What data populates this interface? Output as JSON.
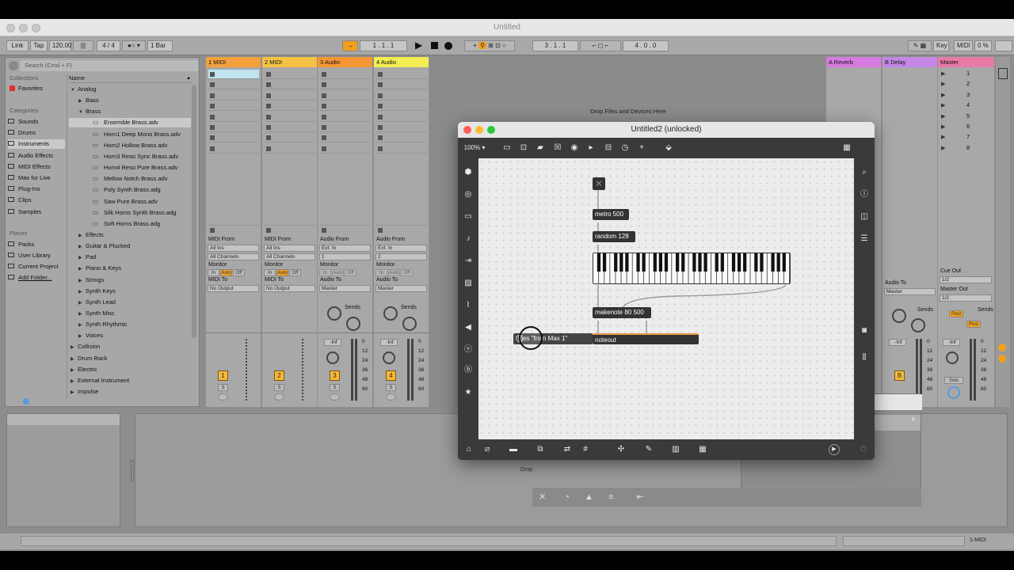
{
  "window": {
    "title": "Untitled"
  },
  "transport": {
    "link": "Link",
    "tap": "Tap",
    "tempo": "120.00",
    "signature": "4 / 4",
    "quantize": "1 Bar",
    "arrangement_pos": "1 . 1 . 1",
    "loop_start": "3 . 1 . 1",
    "loop_length": "4 . 0 . 0",
    "key": "Key",
    "midi": "MIDI",
    "cpu": "0 %"
  },
  "browser": {
    "search_placeholder": "Search (Cmd + F)",
    "collections_header": "Collections",
    "favorites": "Favorites",
    "categories_header": "Categories",
    "categories": [
      "Sounds",
      "Drums",
      "Instruments",
      "Audio Effects",
      "MIDI Effects",
      "Max for Live",
      "Plug-Ins",
      "Clips",
      "Samples"
    ],
    "places_header": "Places",
    "places": [
      "Packs",
      "User Library",
      "Current Project",
      "Add Folder..."
    ],
    "name_header": "Name",
    "tree": [
      {
        "label": "Analog",
        "depth": 0,
        "arrow": "▼"
      },
      {
        "label": "Bass",
        "depth": 1,
        "arrow": "▶"
      },
      {
        "label": "Brass",
        "depth": 1,
        "arrow": "▼"
      },
      {
        "label": "Ensemble Brass.adv",
        "depth": 2,
        "arrow": ""
      },
      {
        "label": "Horn1 Deep Mono Brass.adv",
        "depth": 2,
        "arrow": ""
      },
      {
        "label": "Horn2 Hollow Brass.adv",
        "depth": 2,
        "arrow": ""
      },
      {
        "label": "Horn3 Reso Sync Brass.adv",
        "depth": 2,
        "arrow": ""
      },
      {
        "label": "Horn4 Reso Pure Brass.adv",
        "depth": 2,
        "arrow": ""
      },
      {
        "label": "Mellow Notch Brass.adv",
        "depth": 2,
        "arrow": ""
      },
      {
        "label": "Poly Synth Brass.adg",
        "depth": 2,
        "arrow": ""
      },
      {
        "label": "Saw Pure Brass.adv",
        "depth": 2,
        "arrow": ""
      },
      {
        "label": "Silk Horns Synth Brass.adg",
        "depth": 2,
        "arrow": ""
      },
      {
        "label": "Soft Horns Brass.adg",
        "depth": 2,
        "arrow": ""
      },
      {
        "label": "Effects",
        "depth": 1,
        "arrow": "▶"
      },
      {
        "label": "Guitar & Plucked",
        "depth": 1,
        "arrow": "▶"
      },
      {
        "label": "Pad",
        "depth": 1,
        "arrow": "▶"
      },
      {
        "label": "Piano & Keys",
        "depth": 1,
        "arrow": "▶"
      },
      {
        "label": "Strings",
        "depth": 1,
        "arrow": "▶"
      },
      {
        "label": "Synth Keys",
        "depth": 1,
        "arrow": "▶"
      },
      {
        "label": "Synth Lead",
        "depth": 1,
        "arrow": "▶"
      },
      {
        "label": "Synth Misc",
        "depth": 1,
        "arrow": "▶"
      },
      {
        "label": "Synth Rhythmic",
        "depth": 1,
        "arrow": "▶"
      },
      {
        "label": "Voices",
        "depth": 1,
        "arrow": "▶"
      },
      {
        "label": "Collision",
        "depth": 0,
        "arrow": "▶"
      },
      {
        "label": "Drum Rack",
        "depth": 0,
        "arrow": "▶"
      },
      {
        "label": "Electric",
        "depth": 0,
        "arrow": "▶"
      },
      {
        "label": "External Instrument",
        "depth": 0,
        "arrow": "▶"
      },
      {
        "label": "Impulse",
        "depth": 0,
        "arrow": "▶"
      }
    ]
  },
  "tracks": [
    {
      "name": "1 MIDI",
      "color": "#f3a13c",
      "from_label": "MIDI From",
      "from": "All Ins",
      "chan": "All Channels",
      "monitor": "Monitor",
      "to_label": "MIDI To",
      "to": "No Output",
      "num": "1",
      "type": "midi"
    },
    {
      "name": "2 MIDI",
      "color": "#f5c244",
      "from_label": "MIDI From",
      "from": "All Ins",
      "chan": "All Channels",
      "monitor": "Monitor",
      "to_label": "MIDI To",
      "to": "No Output",
      "num": "2",
      "type": "midi"
    },
    {
      "name": "3 Audio",
      "color": "#f69736",
      "from_label": "Audio From",
      "from": "Ext. In",
      "chan": "1",
      "monitor": "Monitor",
      "to_label": "Audio To",
      "to": "Master",
      "num": "3",
      "type": "audio"
    },
    {
      "name": "4 Audio",
      "color": "#f3ee52",
      "from_label": "Audio From",
      "from": "Ext. In",
      "chan": "2",
      "monitor": "Monitor",
      "to_label": "Audio To",
      "to": "Master",
      "num": "4",
      "type": "audio"
    }
  ],
  "monitor_options": [
    "In",
    "Auto",
    "Off"
  ],
  "sends_label": "Sends",
  "vol_label": "-Inf",
  "meter_scale": [
    "0",
    "12",
    "24",
    "36",
    "48",
    "60"
  ],
  "solo_label": "S",
  "drop_files": "Drop Files and Devices Here",
  "returns": [
    {
      "name": "A Reverb",
      "color": "#d67be0"
    },
    {
      "name": "B Delay",
      "color": "#c587e6"
    },
    {
      "name": "Master",
      "color": "#e77ba6"
    }
  ],
  "scenes": [
    "1",
    "2",
    "3",
    "4",
    "5",
    "6",
    "7",
    "8"
  ],
  "master": {
    "cue_out_label": "Cue Out",
    "cue_out": "1/2",
    "master_out_label": "Master Out",
    "master_out": "1/2",
    "audio_to_label": "Audio To",
    "audio_to": "Master",
    "post": "Post",
    "solo": "Solo",
    "b": "B"
  },
  "max_window": {
    "title": "Untitled2 (unlocked)",
    "zoom": "100%",
    "objects": {
      "metro": "metro 500",
      "random": "random 128",
      "makenote": "makenote 80 500",
      "message": "\"from Max 1\"",
      "message_prefix": "l",
      "message_mid": "dr",
      "message_tail": "es",
      "noteout": "noteout"
    }
  },
  "status": {
    "track": "1-MIDI"
  },
  "colors": {
    "accent": "#f0a020",
    "max_canvas": "#ececec"
  }
}
